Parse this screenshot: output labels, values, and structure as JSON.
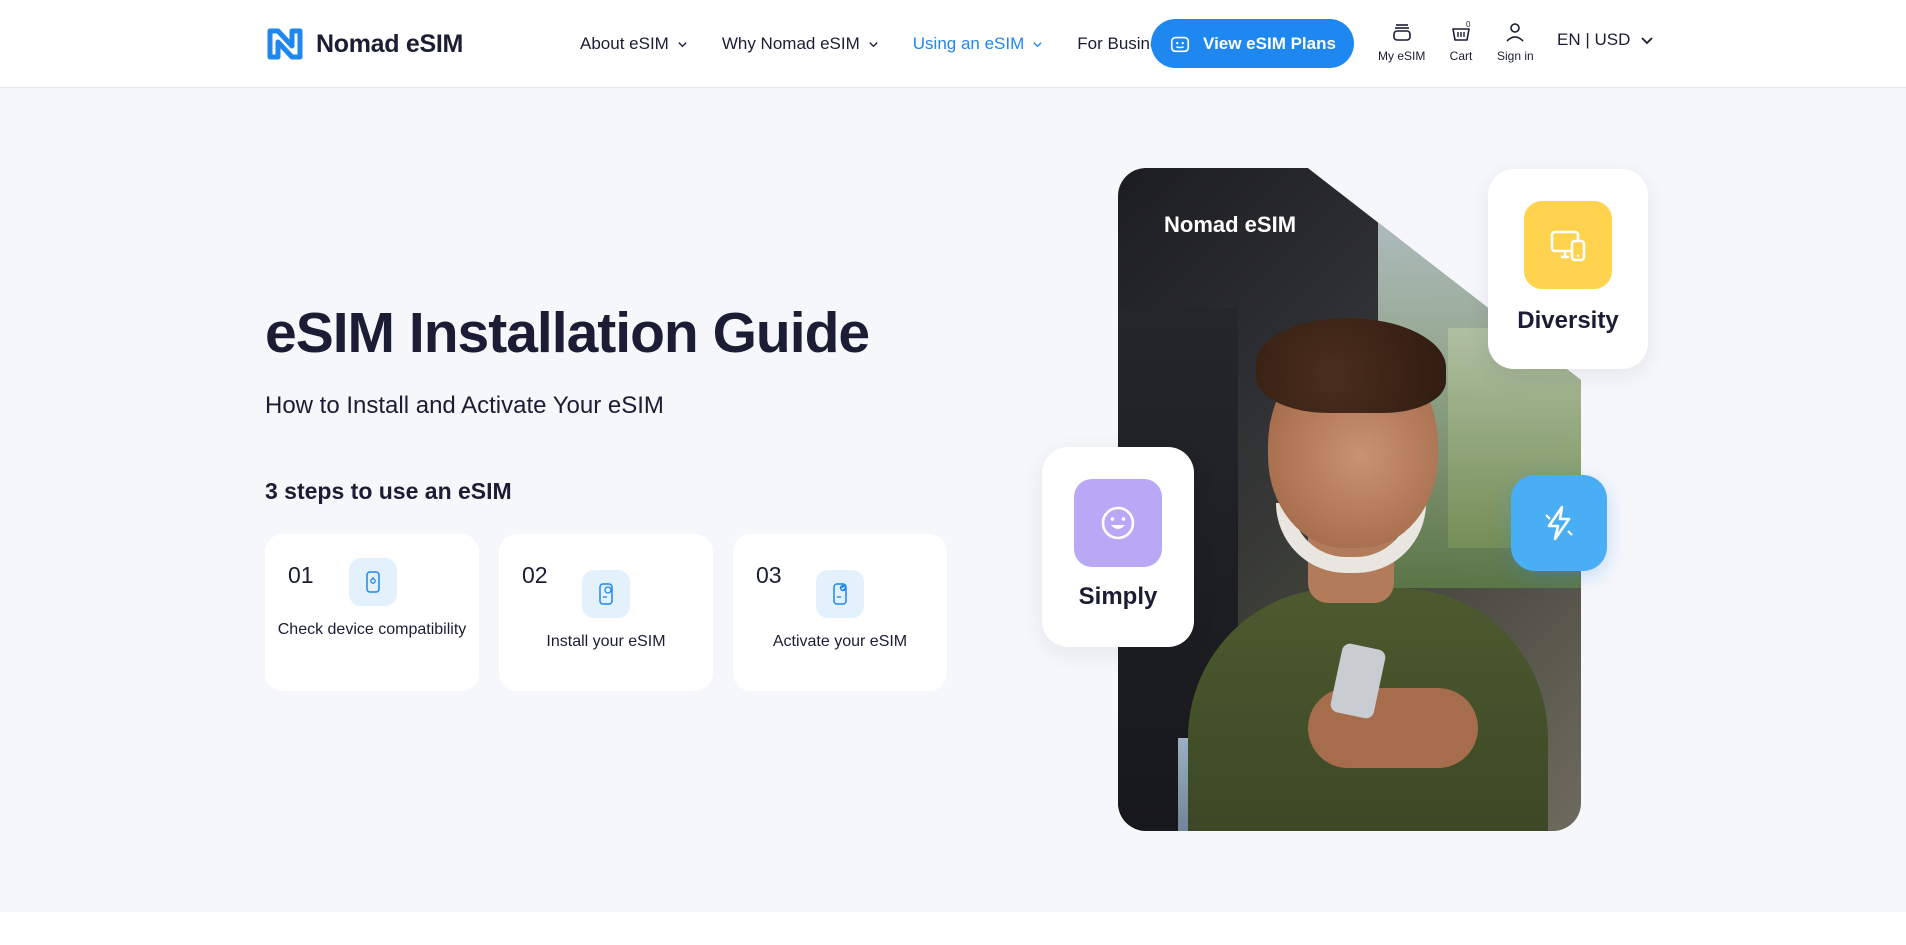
{
  "header": {
    "brand": "Nomad eSIM",
    "nav": [
      {
        "label": "About eSIM",
        "dropdown": true,
        "active": false
      },
      {
        "label": "Why Nomad eSIM",
        "dropdown": true,
        "active": false
      },
      {
        "label": "Using an eSIM",
        "dropdown": true,
        "active": true
      },
      {
        "label": "For Business",
        "dropdown": false,
        "active": false
      }
    ],
    "cta": "View eSIM Plans",
    "my_esim": "My eSIM",
    "cart": "Cart",
    "cart_count": "0",
    "sign_in": "Sign in",
    "locale": "EN | USD"
  },
  "hero": {
    "title": "eSIM Installation Guide",
    "subtitle": "How to Install and Activate Your eSIM",
    "steps_heading": "3 steps to use an eSIM",
    "steps": [
      {
        "number": "01",
        "label": "Check device compatibility",
        "icon": "phone-check-icon"
      },
      {
        "number": "02",
        "label": "Install your eSIM",
        "icon": "phone-install-icon"
      },
      {
        "number": "03",
        "label": "Activate your eSIM",
        "icon": "phone-activate-icon"
      }
    ],
    "photo_logo": "Nomad eSIM",
    "features": [
      {
        "label": "Diversity",
        "icon": "devices-icon",
        "color": "#ffd34d"
      },
      {
        "label": "Simply",
        "icon": "smiley-icon",
        "color": "#b9a8f5"
      }
    ],
    "bolt_icon": "lightning-icon"
  },
  "colors": {
    "primary": "#1e87f0",
    "text": "#1a1d33",
    "background": "#f6f7fb",
    "step_icon_bg": "#e3f1fd",
    "bolt": "#4aaef5"
  }
}
